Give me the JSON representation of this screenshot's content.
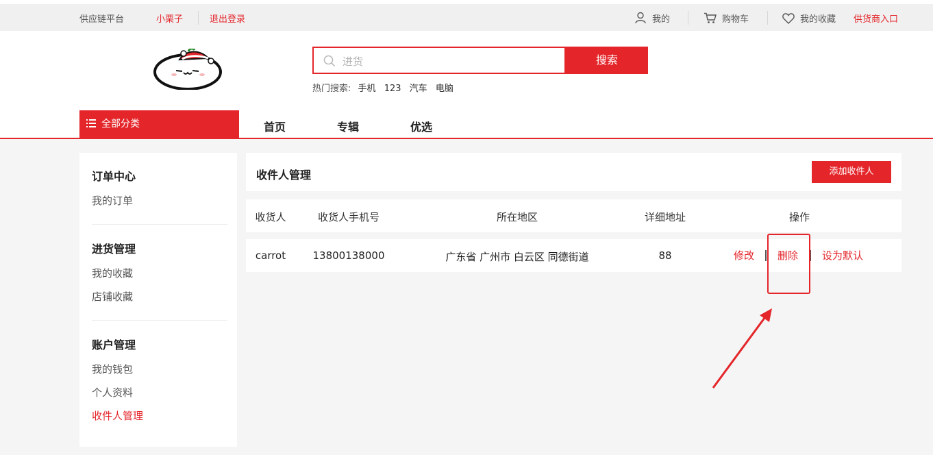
{
  "topbar": {
    "platform": "供应链平台",
    "username": "小栗子",
    "logout": "退出登录",
    "mine": "我的",
    "cart": "购物车",
    "favorites": "我的收藏",
    "supplier_entry": "供货商入口"
  },
  "search": {
    "placeholder": "进货",
    "button": "搜索",
    "hot_label": "热门搜索:",
    "hot_keywords": [
      "手机",
      "123",
      "汽车",
      "电脑"
    ]
  },
  "nav": {
    "all_categories": "全部分类",
    "items": [
      "首页",
      "专辑",
      "优选"
    ]
  },
  "sidebar": {
    "sections": [
      {
        "title": "订单中心",
        "links": [
          "我的订单"
        ]
      },
      {
        "title": "进货管理",
        "links": [
          "我的收藏",
          "店铺收藏"
        ]
      },
      {
        "title": "账户管理",
        "links": [
          "我的钱包",
          "个人资料",
          "收件人管理"
        ]
      }
    ],
    "active_link": "收件人管理"
  },
  "main": {
    "title": "收件人管理",
    "add_button": "添加收件人",
    "columns": [
      "收货人",
      "收货人手机号",
      "所在地区",
      "详细地址",
      "操作"
    ],
    "rows": [
      {
        "name": "carrot",
        "phone": "13800138000",
        "region": "广东省 广州市 白云区 同德街道",
        "address": "88",
        "actions": [
          "修改",
          "删除",
          "设为默认"
        ]
      }
    ]
  },
  "colors": {
    "accent": "#e4252a"
  }
}
